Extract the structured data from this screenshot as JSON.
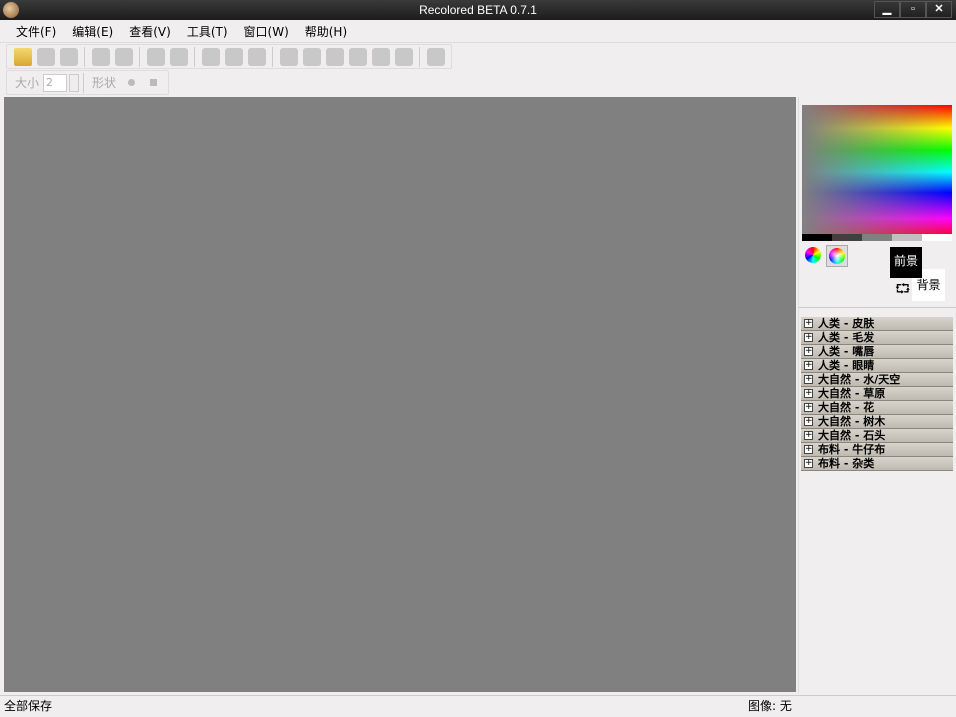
{
  "window": {
    "title": "Recolored BETA 0.7.1",
    "minimize": "▁",
    "maximize": "▫",
    "close": "✕"
  },
  "menu": [
    "文件(F)",
    "编辑(E)",
    "查看(V)",
    "工具(T)",
    "窗口(W)",
    "帮助(H)"
  ],
  "toolbar2": {
    "size_label": "大小",
    "size_value": "2",
    "shape_label": "形状"
  },
  "colors": {
    "foreground_label": "前景",
    "background_label": "背景"
  },
  "categories": [
    "人类 - 皮肤",
    "人类 - 毛发",
    "人类 - 嘴唇",
    "人类 - 眼睛",
    "大自然 - 水/天空",
    "大自然 - 草原",
    "大自然 - 花",
    "大自然 - 树木",
    "大自然 - 石头",
    "布料 - 牛仔布",
    "布料 - 杂类"
  ],
  "status": {
    "left": "全部保存",
    "image": "图像: 无"
  }
}
